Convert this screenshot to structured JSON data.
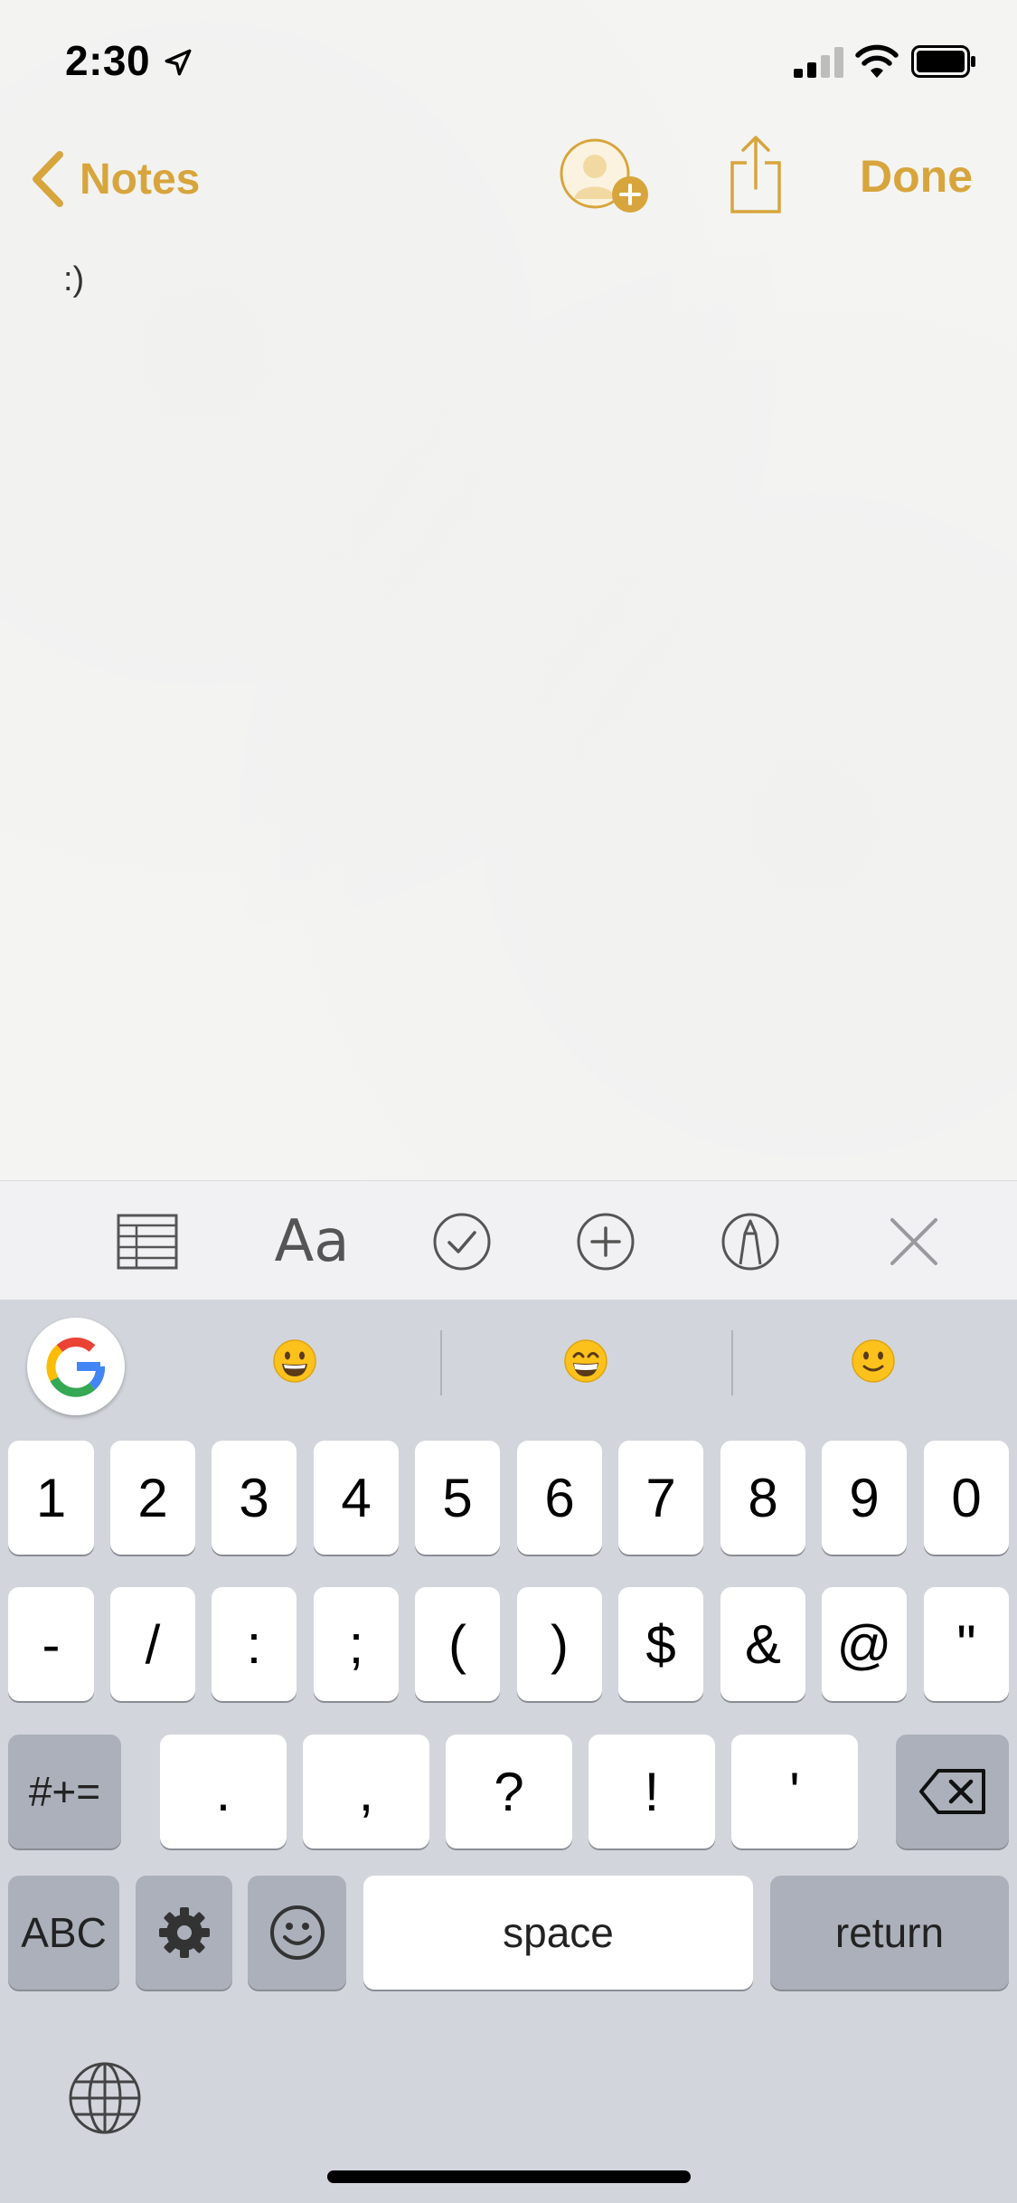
{
  "status_bar": {
    "time": "2:30"
  },
  "nav": {
    "back_label": "Notes",
    "done_label": "Done"
  },
  "note": {
    "text": ":)"
  },
  "format_bar": {
    "text_style_label": "Aa"
  },
  "keyboard": {
    "suggestions": [
      "grinning-face-emoji",
      "beaming-face-emoji",
      "slightly-smiling-face-emoji"
    ],
    "row1": [
      "1",
      "2",
      "3",
      "4",
      "5",
      "6",
      "7",
      "8",
      "9",
      "0"
    ],
    "row2": [
      "-",
      "/",
      ":",
      ";",
      "(",
      ")",
      "$",
      "&",
      "@",
      "\""
    ],
    "row3": {
      "shift_label": "#+=",
      "keys": [
        ".",
        ",",
        "?",
        "!",
        "'"
      ]
    },
    "row4": {
      "abc_label": "ABC",
      "space_label": "space",
      "return_label": "return"
    }
  },
  "colors": {
    "accent": "#d7a53c",
    "keyboard_bg": "#d2d5db",
    "dark_key": "#abb0ba"
  }
}
